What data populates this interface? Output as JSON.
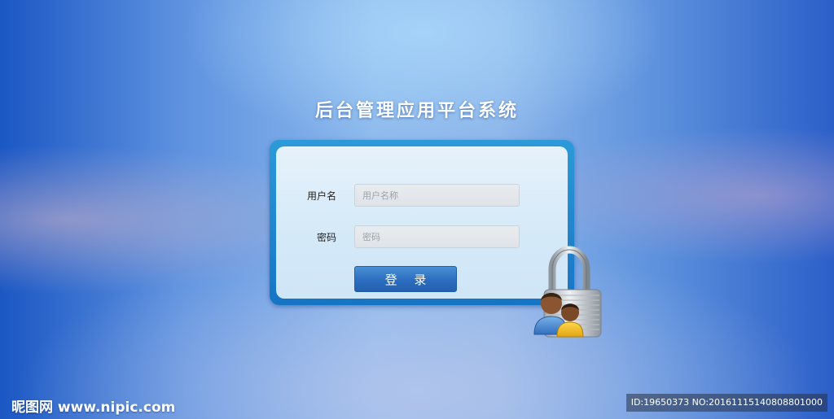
{
  "page": {
    "title": "后台管理应用平台系统"
  },
  "form": {
    "username_label": "用户名",
    "username_placeholder": "用户名称",
    "username_value": "",
    "password_label": "密码",
    "password_placeholder": "密码",
    "password_value": "",
    "login_label": "登 录"
  },
  "decor": {
    "lock_icon": "padlock-with-users-icon"
  },
  "watermark": {
    "logo_text": "昵图网 www.nipic.com",
    "id_text": "ID:19650373 NO:20161115140808801000"
  },
  "colors": {
    "panel_border": "#1674c4",
    "button": "#2b6dbf",
    "panel_fill": "#dcecf9"
  }
}
